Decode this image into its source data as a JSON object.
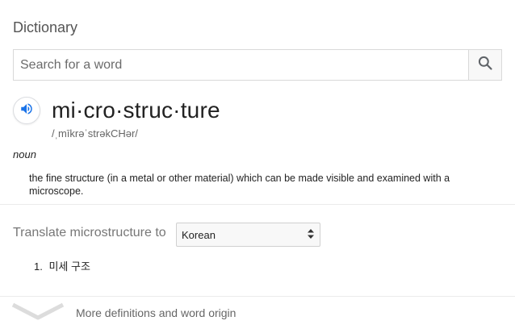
{
  "header": {
    "title": "Dictionary"
  },
  "search": {
    "placeholder": "Search for a word",
    "value": ""
  },
  "entry": {
    "word": "mi·cro·struc·ture",
    "phonetic": "/ˌmīkrəˈstrəkCHər/",
    "part_of_speech": "noun",
    "definition": "the fine structure (in a metal or other material) which can be made visible and examined with a microscope."
  },
  "translate": {
    "label": "Translate microstructure to",
    "selected_language": "Korean",
    "results": [
      {
        "num": "1.",
        "text": "미세 구조"
      }
    ]
  },
  "footer": {
    "more_label": "More definitions and word origin"
  },
  "icons": {
    "search": "search-icon",
    "speaker": "speaker-icon",
    "select_arrows": "updown-arrows-icon",
    "expand": "chevron-down-icon"
  },
  "colors": {
    "accent": "#1a73e8",
    "muted": "#777777"
  }
}
